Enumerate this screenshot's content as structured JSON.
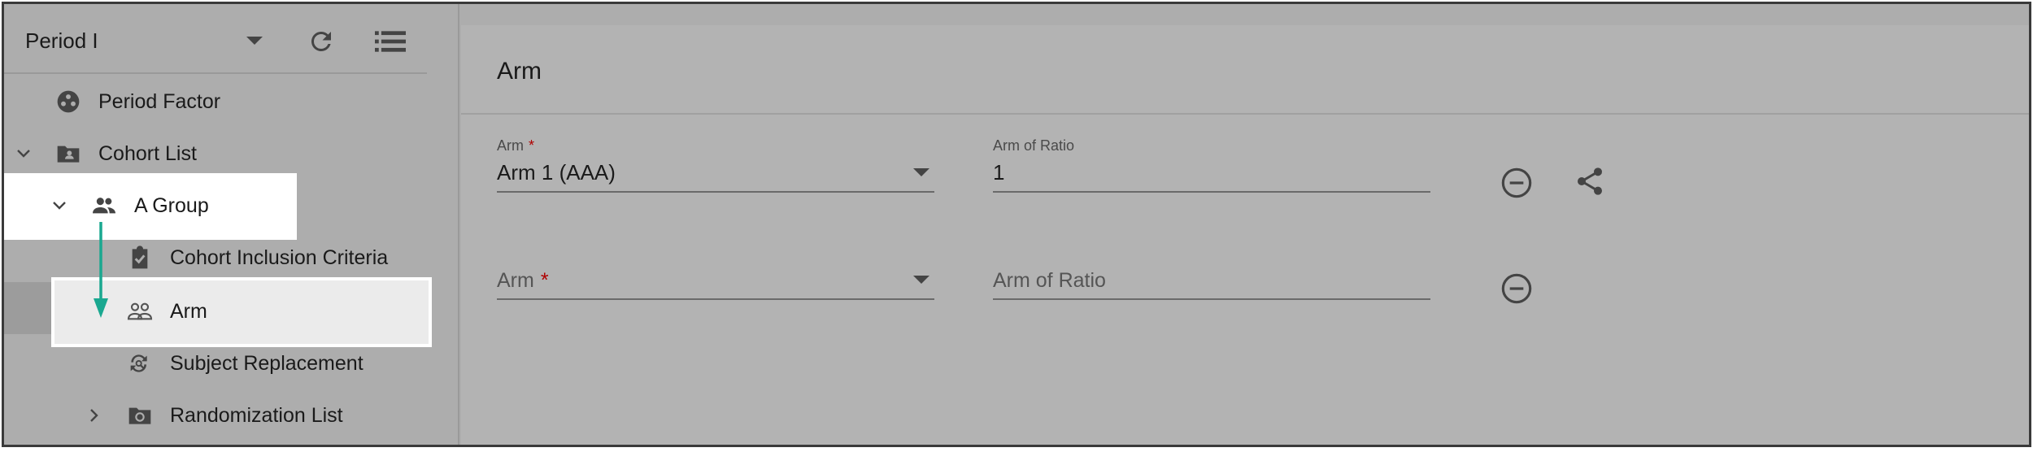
{
  "sidebar": {
    "period_selector": {
      "value": "Period I",
      "refresh_icon": "refresh-icon",
      "list_icon": "list-icon"
    },
    "items": [
      {
        "label": "Period Factor",
        "icon": "factor-icon"
      },
      {
        "label": "Cohort List",
        "icon": "folder-account-icon",
        "expanded": true
      },
      {
        "label": "A Group",
        "icon": "people-icon",
        "expanded": true
      },
      {
        "label": "Cohort Inclusion Criteria",
        "icon": "clipboard-check-icon"
      },
      {
        "label": "Arm",
        "icon": "people-outline-icon",
        "selected": true
      },
      {
        "label": "Subject Replacement",
        "icon": "replace-icon"
      },
      {
        "label": "Randomization List",
        "icon": "folder-sync-icon",
        "expanded": false
      }
    ]
  },
  "main": {
    "title": "Arm",
    "rows": [
      {
        "arm_label": "Arm",
        "arm_value": "Arm 1 (AAA)",
        "ratio_label": "Arm of Ratio",
        "ratio_value": "1",
        "actions": [
          "remove-circle-icon",
          "share-icon"
        ]
      },
      {
        "arm_placeholder": "Arm",
        "ratio_placeholder": "Arm of Ratio",
        "actions": [
          "remove-circle-icon"
        ]
      }
    ],
    "required_marker": "*"
  },
  "annotation": {
    "arrow_color": "#1aa890"
  },
  "colors": {
    "required": "#b00000",
    "overlay": "#adadad"
  }
}
